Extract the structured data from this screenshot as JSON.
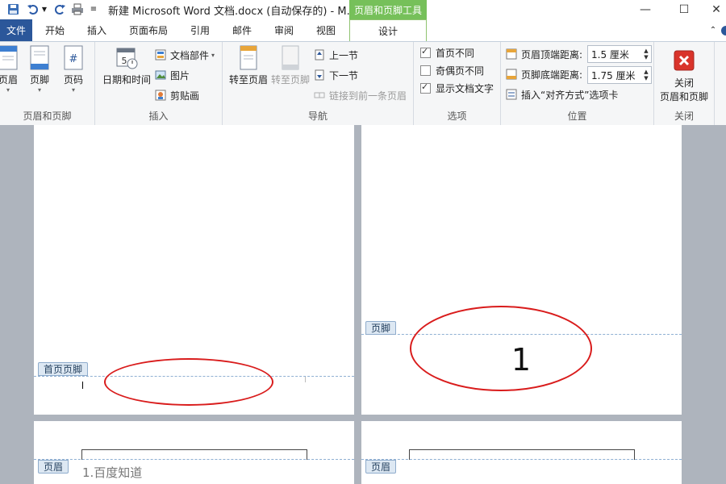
{
  "title_bar": {
    "title": "新建 Microsoft Word 文档.docx (自动保存的) - M..",
    "context_tab_header": "页眉和页脚工具",
    "icons": [
      "save-icon",
      "undo-icon",
      "redo-icon",
      "print-icon",
      "customize-icon"
    ]
  },
  "tabs": [
    {
      "label": "文件"
    },
    {
      "label": "开始"
    },
    {
      "label": "插入"
    },
    {
      "label": "页面布局"
    },
    {
      "label": "引用"
    },
    {
      "label": "邮件"
    },
    {
      "label": "审阅"
    },
    {
      "label": "视图"
    },
    {
      "label": "设计"
    }
  ],
  "groups": {
    "header_footer": {
      "label": "页眉和页脚",
      "buttons": [
        {
          "label": "页眉"
        },
        {
          "label": "页脚"
        },
        {
          "label": "页码"
        }
      ]
    },
    "insert": {
      "label": "插入",
      "datetime": "日期和时间",
      "quick_parts": "文档部件",
      "picture": "图片",
      "clipart": "剪贴画"
    },
    "navigation": {
      "label": "导航",
      "goto_header": "转至页眉",
      "goto_footer": "转至页脚",
      "previous": "上一节",
      "next": "下一节",
      "link_previous": "链接到前一条页眉"
    },
    "options": {
      "label": "选项",
      "different_first": {
        "label": "首页不同",
        "checked": true
      },
      "different_odd_even": {
        "label": "奇偶页不同",
        "checked": false
      },
      "show_doc_text": {
        "label": "显示文档文字",
        "checked": true
      }
    },
    "position": {
      "label": "位置",
      "header_top_label": "页眉顶端距离:",
      "header_top_value": "1.5 厘米",
      "footer_bottom_label": "页脚底端距离:",
      "footer_bottom_value": "1.75 厘米",
      "insert_align_tab": "插入“对齐方式”选项卡"
    },
    "close": {
      "label": "关闭",
      "button_line1": "关闭",
      "button_line2": "页眉和页脚"
    }
  },
  "document": {
    "first_page_footer_tag": "首页页脚",
    "footer_tag": "页脚",
    "page_number": "1",
    "header_tag": "页眉",
    "header_text": "1.百度知道"
  },
  "colors": {
    "accent_file_tab": "#2b579a",
    "context_tab": "#76c05a",
    "annotation_ellipse": "#d91c1c"
  }
}
